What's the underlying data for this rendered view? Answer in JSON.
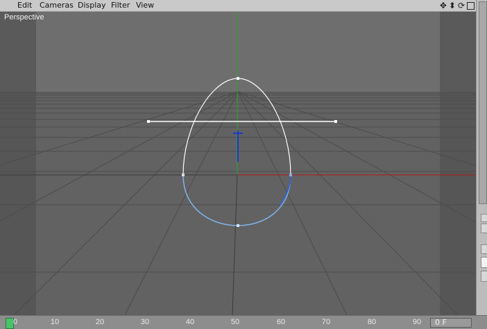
{
  "menubar": {
    "items": [
      "Edit",
      "Cameras",
      "Display",
      "Filter",
      "View"
    ],
    "nav_icons": [
      "move-view-icon",
      "dolly-view-icon",
      "rotate-view-icon",
      "maximize-view-icon"
    ]
  },
  "viewport": {
    "label": "Perspective",
    "grid_color": "#4a4a4a",
    "x_axis_color": "#b01818",
    "y_axis_color": "#22aa22",
    "z_axis_color": "#1a3ad0",
    "spline_color": "#ffffff",
    "selected_spline_color": "#7fb2e8"
  },
  "timeline": {
    "ticks": [
      "0",
      "10",
      "20",
      "30",
      "40",
      "50",
      "60",
      "70",
      "80",
      "90"
    ],
    "current_frame": "0 F"
  }
}
